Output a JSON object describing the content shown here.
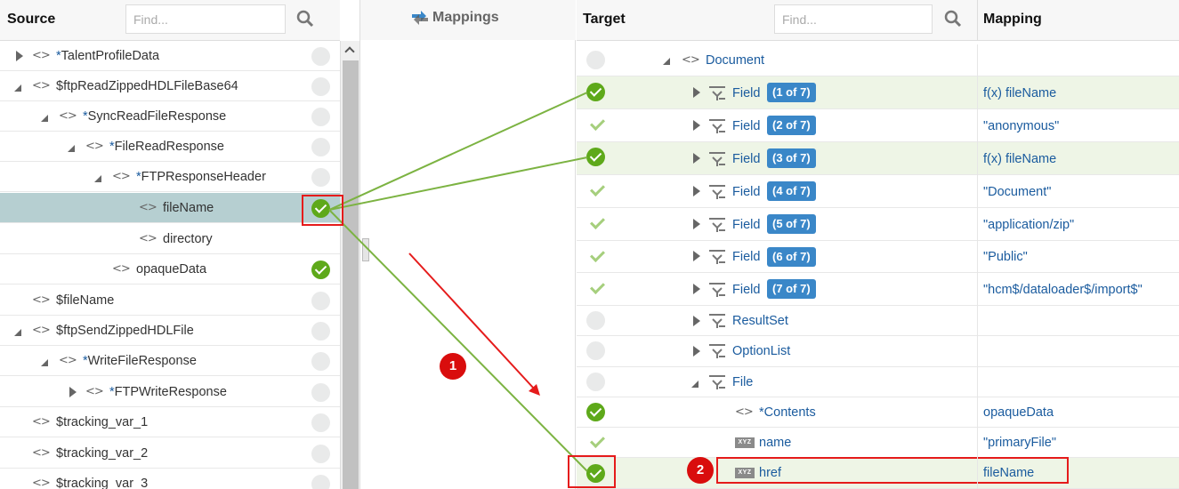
{
  "source": {
    "title": "Source",
    "find_placeholder": "Find...",
    "rows": [
      {
        "label": "TalentProfileData",
        "req": true,
        "state": "empty"
      },
      {
        "label": "$ftpReadZippedHDLFileBase64",
        "req": false,
        "state": "empty"
      },
      {
        "label": "SyncReadFileResponse",
        "req": true,
        "state": "empty"
      },
      {
        "label": "FileReadResponse",
        "req": true,
        "state": "empty"
      },
      {
        "label": "FTPResponseHeader",
        "req": true,
        "state": "empty"
      },
      {
        "label": "fileName",
        "req": false,
        "state": "mapped",
        "selected": true
      },
      {
        "label": "directory",
        "req": false,
        "state": "none"
      },
      {
        "label": "opaqueData",
        "req": false,
        "state": "mapped"
      },
      {
        "label": "$fileName",
        "req": false,
        "state": "empty"
      },
      {
        "label": "$ftpSendZippedHDLFile",
        "req": false,
        "state": "empty"
      },
      {
        "label": "WriteFileResponse",
        "req": true,
        "state": "empty"
      },
      {
        "label": "FTPWriteResponse",
        "req": true,
        "state": "empty"
      },
      {
        "label": "$tracking_var_1",
        "req": false,
        "state": "empty"
      },
      {
        "label": "$tracking_var_2",
        "req": false,
        "state": "empty"
      },
      {
        "label": "$tracking_var_3",
        "req": false,
        "state": "empty"
      }
    ]
  },
  "mappings": {
    "title": "Mappings"
  },
  "target": {
    "title": "Target",
    "find_placeholder": "Find...",
    "mapping_title": "Mapping",
    "rows": [
      {
        "label": "Document",
        "mapping": "",
        "state": "empty"
      },
      {
        "label": "Field",
        "badge": "1 of 7",
        "mapping": "f(x) fileName",
        "state": "mapped"
      },
      {
        "label": "Field",
        "badge": "2 of 7",
        "mapping": "\"anonymous\"",
        "state": "tick"
      },
      {
        "label": "Field",
        "badge": "3 of 7",
        "mapping": "f(x) fileName",
        "state": "mapped"
      },
      {
        "label": "Field",
        "badge": "4 of 7",
        "mapping": "\"Document\"",
        "state": "tick"
      },
      {
        "label": "Field",
        "badge": "5 of 7",
        "mapping": "\"application/zip\"",
        "state": "tick"
      },
      {
        "label": "Field",
        "badge": "6 of 7",
        "mapping": "\"Public\"",
        "state": "tick"
      },
      {
        "label": "Field",
        "badge": "7 of 7",
        "mapping": "\"hcm$/dataloader$/import$\"",
        "state": "tick"
      },
      {
        "label": "ResultSet",
        "mapping": "",
        "state": "empty"
      },
      {
        "label": "OptionList",
        "mapping": "",
        "state": "empty"
      },
      {
        "label": "File",
        "mapping": "",
        "state": "empty"
      },
      {
        "label": "Contents",
        "req": true,
        "mapping": "opaqueData",
        "state": "mapped"
      },
      {
        "label": "name",
        "mapping": "\"primaryFile\"",
        "state": "tick"
      },
      {
        "label": "href",
        "mapping": "fileName",
        "state": "mapped"
      }
    ]
  },
  "annotations": {
    "step1": "1",
    "step2": "2"
  },
  "colors": {
    "mapped_green": "#5ea91a",
    "link_line": "#7cb342",
    "highlight_row": "#eef5e6",
    "selected_row": "#b6cfd1",
    "annotation_red": "#e51b1b",
    "badge_blue": "#3a87c8"
  }
}
